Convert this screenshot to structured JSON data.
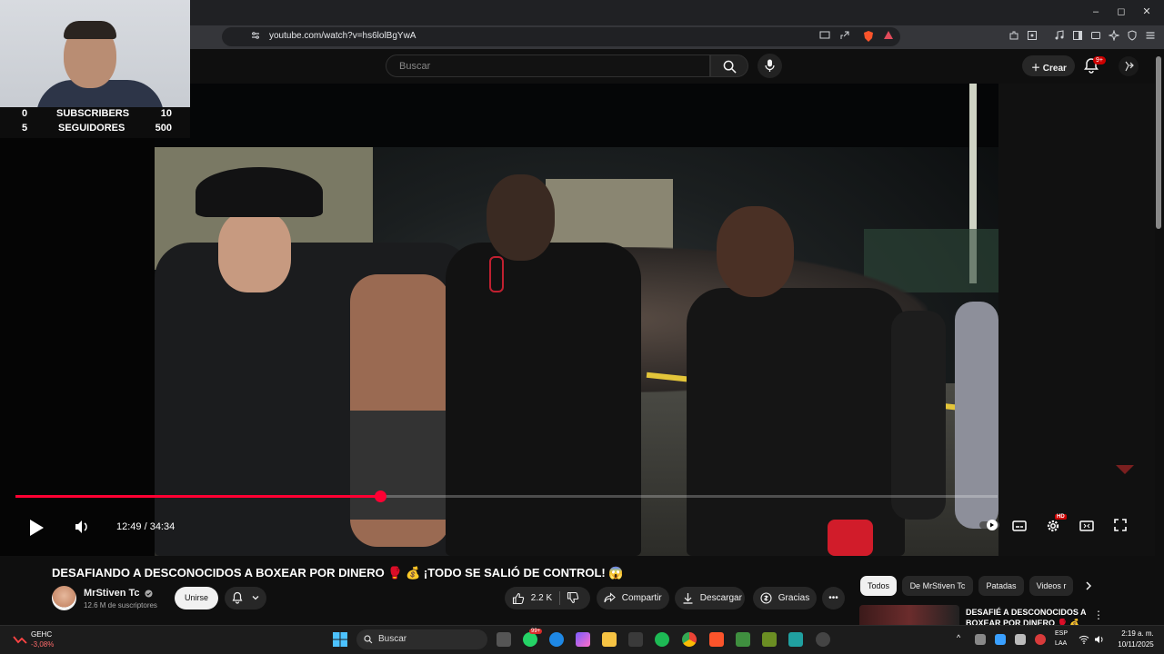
{
  "browser": {
    "url": "youtube.com/watch?v=hs6lolBgYwA",
    "minimize_glyph": "–",
    "maximize_glyph": "◻",
    "close_glyph": "✕"
  },
  "header": {
    "search_placeholder": "Buscar",
    "create_label": "Crear",
    "notif_badge": "9+"
  },
  "webcam_overlay": {
    "rows": [
      {
        "left": "0",
        "label": "SUBSCRIBERS",
        "right": "10"
      },
      {
        "left": "5",
        "label": "SEGUIDORES",
        "right": "500"
      }
    ]
  },
  "player": {
    "time_display": "12:49 / 34:34",
    "progress_fraction": 0.371,
    "hd_badge": "HD",
    "accent": "#ff0033"
  },
  "video": {
    "title": "DESAFIANDO A DESCONOCIDOS A BOXEAR POR DINERO 🥊 💰 ¡TODO SE SALIÓ DE CONTROL! 😱",
    "channel_name": "MrStiven Tc",
    "subscribers": "12.6 M de suscriptores",
    "join_label": "Unirse",
    "likes": "2.2 K",
    "share_label": "Compartir",
    "download_label": "Descargar",
    "thanks_label": "Gracias"
  },
  "chips": {
    "all": "Todos",
    "channel": "De MrStiven Tc",
    "kicks": "Patadas",
    "videos": "Videos r"
  },
  "suggestion": {
    "title": "DESAFIÉ A DESCONOCIDOS A BOXEAR POR DINERO 🥊 💰"
  },
  "taskbar": {
    "stock_name": "GEHC",
    "stock_change": "-3,08%",
    "search_label": "Buscar",
    "whatsapp_badge": "99+",
    "lang_top": "ESP",
    "lang_bottom": "LAA",
    "time": "2:19 a. m.",
    "date": "10/11/2025"
  }
}
